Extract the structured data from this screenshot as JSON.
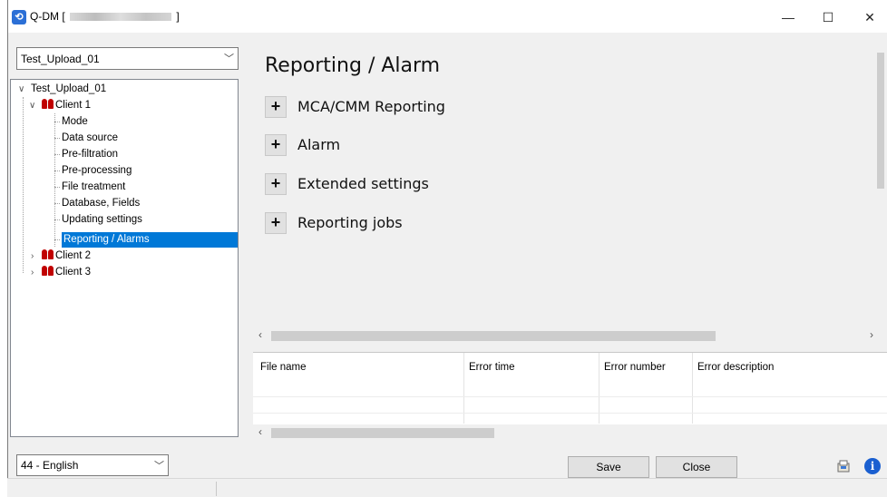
{
  "window": {
    "title_prefix": "Q-DM [",
    "title_suffix": "]",
    "minimize": "—",
    "maximize": "☐",
    "close": "✕"
  },
  "project_combo": {
    "value": "Test_Upload_01"
  },
  "tree": {
    "root": "Test_Upload_01",
    "client1": "Client 1",
    "client1_children": [
      "Mode",
      "Data source",
      "Pre-filtration",
      "Pre-processing",
      "File treatment",
      "Database, Fields",
      "Updating settings",
      "Reporting / Alarms"
    ],
    "selected_index": 7,
    "client2": "Client 2",
    "client3": "Client 3"
  },
  "main": {
    "title": "Reporting / Alarm",
    "sections": [
      {
        "label": "MCA/CMM Reporting",
        "expander": "+"
      },
      {
        "label": "Alarm",
        "expander": "+"
      },
      {
        "label": "Extended settings",
        "expander": "+"
      },
      {
        "label": "Reporting jobs",
        "expander": "+"
      }
    ]
  },
  "error_grid": {
    "columns": [
      "File name",
      "Error time",
      "Error number",
      "Error description"
    ]
  },
  "language_combo": {
    "value": "44 - English"
  },
  "footer": {
    "save_label": "Save",
    "close_label": "Close"
  },
  "icons": {
    "app": "app-icon",
    "export": "export-icon",
    "info": "info-icon"
  },
  "colors": {
    "selection": "#0078d7",
    "client_icon": "#c00000",
    "info": "#1a5fd0"
  }
}
